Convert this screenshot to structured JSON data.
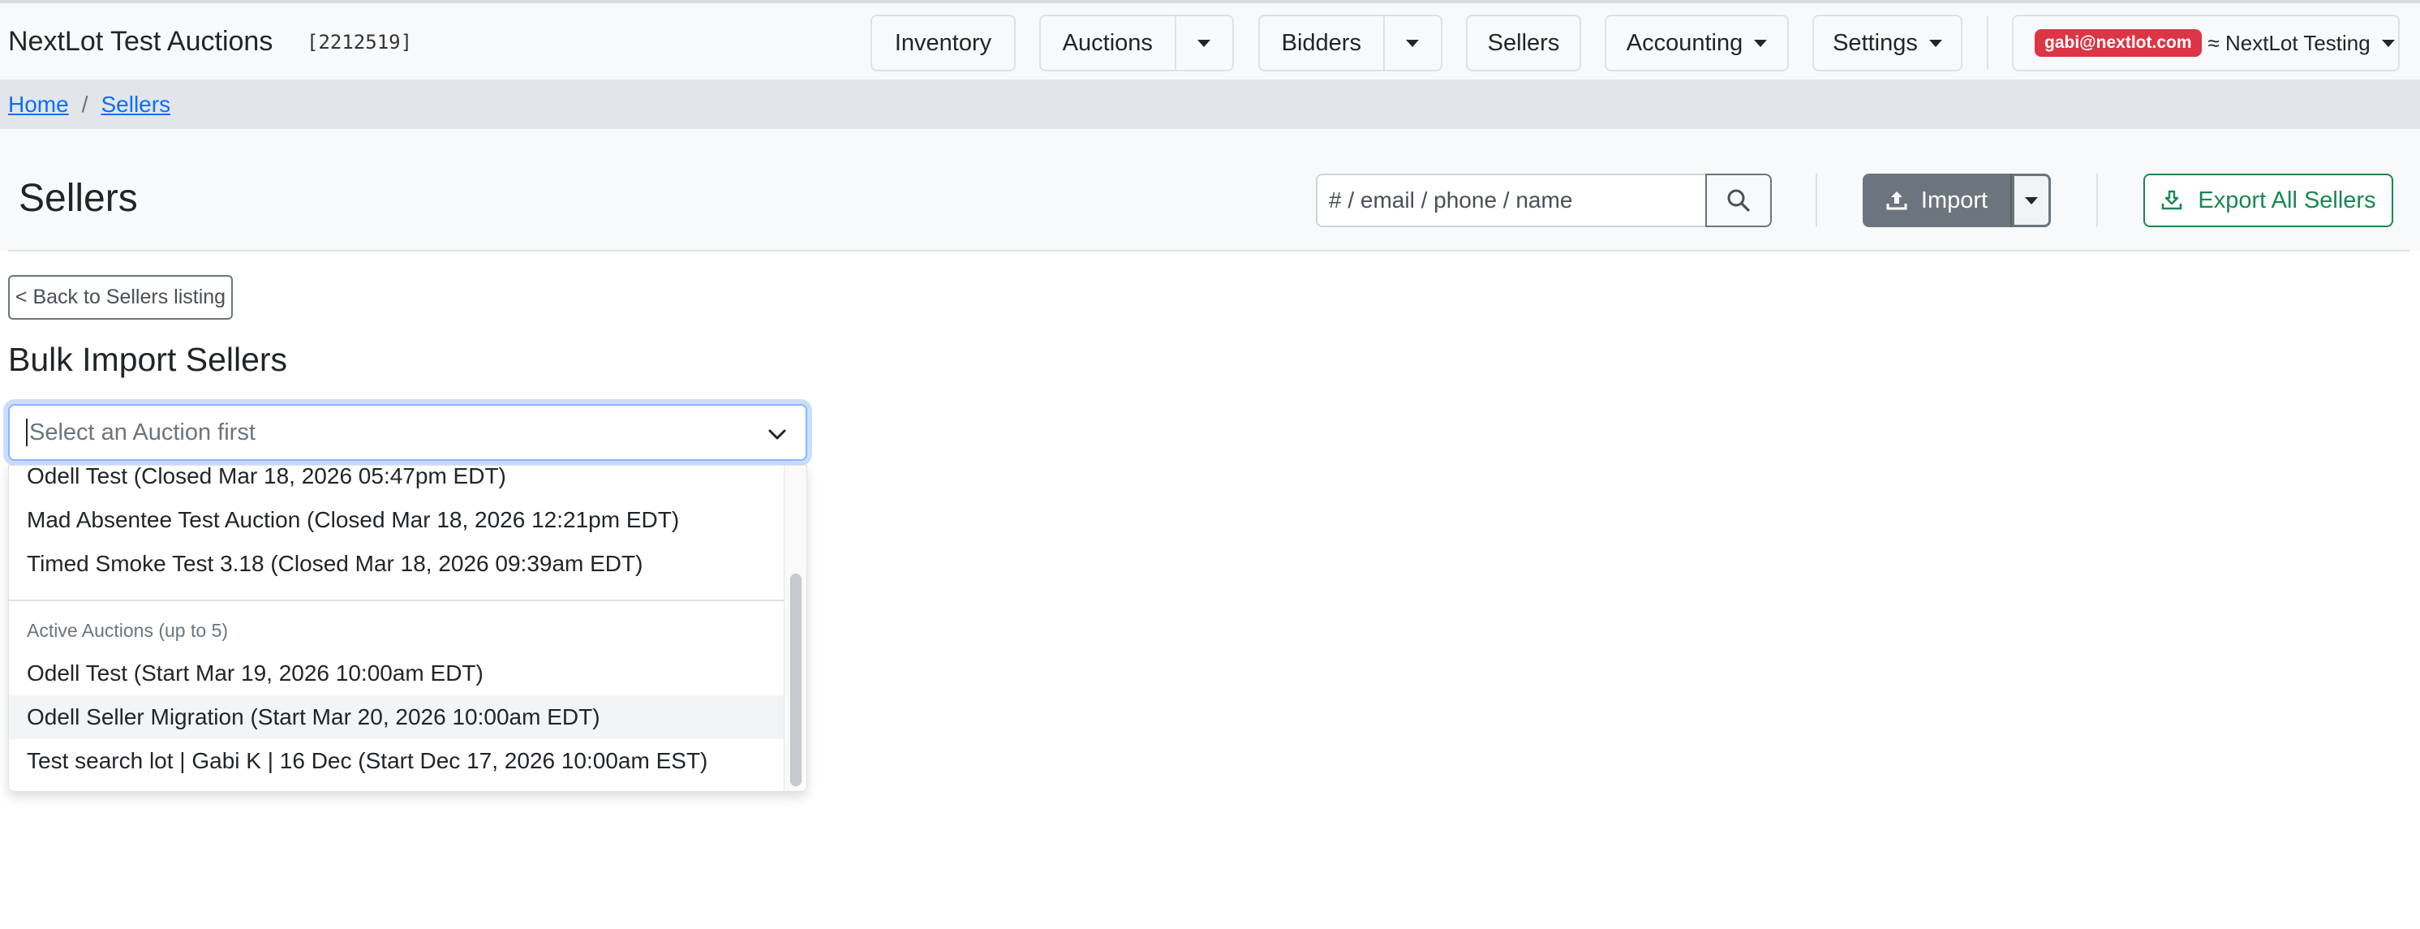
{
  "app": {
    "brand": "NextLot Test Auctions",
    "account_id": "[2212519]"
  },
  "nav": {
    "inventory": "Inventory",
    "auctions": "Auctions",
    "bidders": "Bidders",
    "sellers": "Sellers",
    "accounting": "Accounting",
    "settings": "Settings",
    "user_email": "gabi@nextlot.com",
    "org_name": "≈ NextLot Testing"
  },
  "breadcrumb": {
    "home": "Home",
    "sep": "/",
    "sellers": "Sellers"
  },
  "header": {
    "title": "Sellers",
    "search_placeholder": "# / email / phone / name",
    "import_label": "Import",
    "export_label": "Export All Sellers"
  },
  "content": {
    "back_label": "< Back to Sellers listing",
    "section_title": "Bulk Import Sellers",
    "select_placeholder": "Select an Auction first"
  },
  "dropdown": {
    "closed_options": [
      "Odell Test (Closed Mar 18, 2026 05:47pm EDT)",
      "Mad Absentee Test Auction (Closed Mar 18, 2026 12:21pm EDT)",
      "Timed Smoke Test 3.18 (Closed Mar 18, 2026 09:39am EDT)"
    ],
    "active_group_label": "Active Auctions (up to 5)",
    "active_options": [
      "Odell Test (Start Mar 19, 2026 10:00am EDT)",
      "Odell Seller Migration (Start Mar 20, 2026 10:00am EDT)",
      "Test search lot | Gabi K | 16 Dec (Start Dec 17, 2026 10:00am EST)"
    ],
    "highlighted_option": "Odell Seller Migration (Start Mar 20, 2026 10:00am EDT)"
  },
  "colors": {
    "link": "#0d6efd",
    "badge": "#dc3545",
    "import_button": "#6c757d",
    "export_button": "#198754",
    "focus_ring": "#86b7fe"
  },
  "icons": {
    "search": "search-icon",
    "import": "upload-icon",
    "export": "download-icon",
    "select": "chevron-down-icon"
  }
}
